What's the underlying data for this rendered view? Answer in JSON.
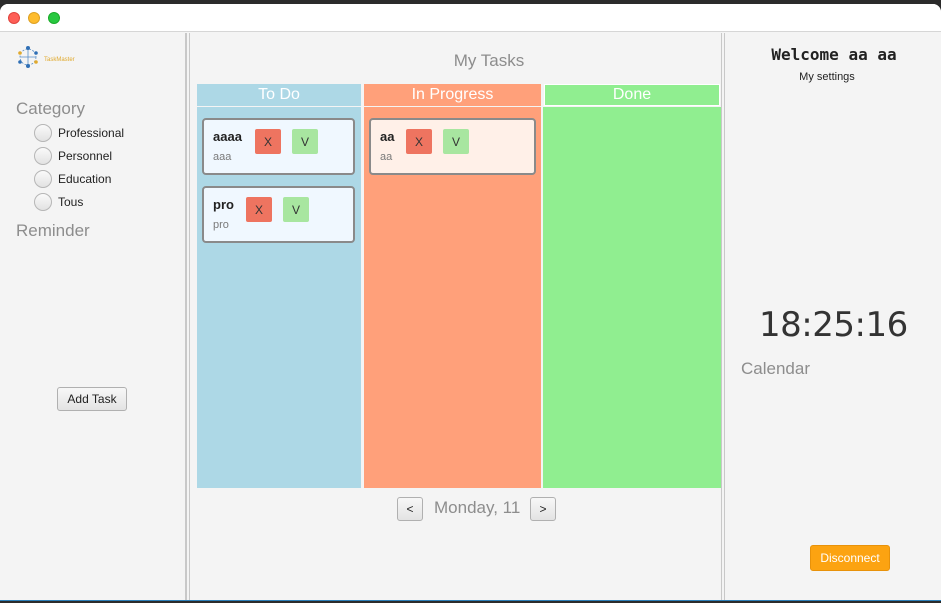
{
  "app": {
    "logo_text": "TaskMaster"
  },
  "sidebar": {
    "category_title": "Category",
    "categories": [
      {
        "label": "Professional"
      },
      {
        "label": "Personnel"
      },
      {
        "label": "Education"
      },
      {
        "label": "Tous"
      }
    ],
    "reminder_title": "Reminder",
    "add_task_label": "Add Task"
  },
  "board": {
    "title": "My Tasks",
    "columns": [
      {
        "label": "To Do",
        "color": "#add8e6",
        "header_color": "#add8e6",
        "card_bg": "#f0f8ff"
      },
      {
        "label": "In Progress",
        "color": "#ffa07a",
        "header_color": "#ffa07a",
        "card_bg": "#fff0e8"
      },
      {
        "label": "Done",
        "color": "#90ee90",
        "header_color": "#90ee90"
      }
    ],
    "todo_cards": [
      {
        "title": "aaaa",
        "subtitle": "aaa",
        "delete_label": "X",
        "done_label": "V"
      },
      {
        "title": "pro",
        "subtitle": "pro",
        "delete_label": "X",
        "done_label": "V"
      }
    ],
    "inprogress_cards": [
      {
        "title": "aa",
        "subtitle": "aa",
        "delete_label": "X",
        "done_label": "V"
      }
    ],
    "nav": {
      "prev_label": "<",
      "date_label": "Monday, 11",
      "next_label": ">"
    }
  },
  "account": {
    "welcome": "Welcome aa aa",
    "settings_label": "My settings",
    "clock": "18:25:16",
    "calendar_label": "Calendar",
    "disconnect_label": "Disconnect"
  },
  "colors": {
    "accent": "#fca311",
    "delete": "#ee7460",
    "validate": "#a8e6a0"
  }
}
